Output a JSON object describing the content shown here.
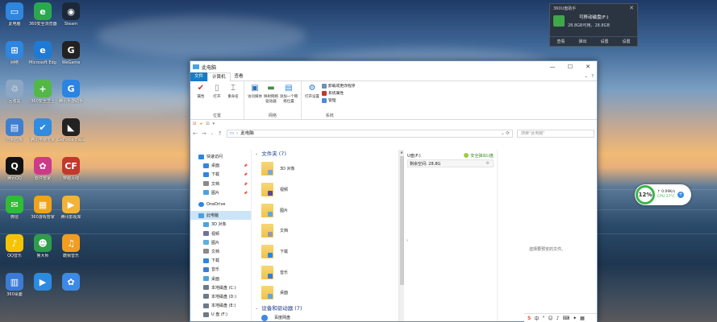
{
  "desktop": {
    "icons": [
      {
        "label": "此电脑",
        "color": "#2e86de",
        "glyph": "▭"
      },
      {
        "label": "360安全浏览器",
        "color": "#2aa84f",
        "glyph": "e"
      },
      {
        "label": "Steam",
        "color": "#1b2838",
        "glyph": "◉"
      },
      {
        "label": "网络",
        "color": "#2e86de",
        "glyph": "⊞"
      },
      {
        "label": "Microsoft Edge",
        "color": "#1f7ad6",
        "glyph": "e"
      },
      {
        "label": "WeGame",
        "color": "#222222",
        "glyph": "G"
      },
      {
        "label": "回收站",
        "color": "#8ca6c4",
        "glyph": "♲"
      },
      {
        "label": "360安全卫士",
        "color": "#53b848",
        "glyph": "+"
      },
      {
        "label": "腾讯手游助手",
        "color": "#2a84e0",
        "glyph": "G"
      },
      {
        "label": "控制面板",
        "color": "#3f7fd1",
        "glyph": "▤"
      },
      {
        "label": "腾讯电脑管家",
        "color": "#2f8ce0",
        "glyph": "✔"
      },
      {
        "label": "GeForce Experience",
        "color": "#222222",
        "glyph": "◣"
      },
      {
        "label": "腾讯QQ",
        "color": "#111111",
        "glyph": "Q"
      },
      {
        "label": "软件管家",
        "color": "#cc3b8a",
        "glyph": "✿"
      },
      {
        "label": "穿越火线",
        "color": "#c0392b",
        "glyph": "CF"
      },
      {
        "label": "微信",
        "color": "#2dbd36",
        "glyph": "✉"
      },
      {
        "label": "360游戏管家",
        "color": "#f0a21b",
        "glyph": "▦"
      },
      {
        "label": "腾讯影视库",
        "color": "#f4b23a",
        "glyph": "▶"
      },
      {
        "label": "QQ音乐",
        "color": "#f5c400",
        "glyph": "♪"
      },
      {
        "label": "鲁大师",
        "color": "#2f9c4c",
        "glyph": "☻"
      },
      {
        "label": "酷我音乐",
        "color": "#f29d1f",
        "glyph": "♫"
      },
      {
        "label": "360桌面",
        "color": "#3b7bd6",
        "glyph": "▥"
      },
      {
        "label": "",
        "color": "#2a8be0",
        "glyph": "▶"
      },
      {
        "label": "",
        "color": "#3b8be6",
        "glyph": "✿"
      }
    ]
  },
  "notification": {
    "header": "360U盘助手",
    "drive_name": "可移动磁盘(F:)",
    "size": "28.8GB可用，28.8GB",
    "actions": [
      "查看",
      "弹出",
      "设置",
      "设置"
    ]
  },
  "widget": {
    "percent": "12%",
    "speed": "↑ 0.09K/s",
    "speed2": "↓ 0.09K/s",
    "cpu": "CPU 37°C"
  },
  "window": {
    "title": "此电脑",
    "controls": {
      "min": "—",
      "max": "☐",
      "close": "✕"
    },
    "menus": {
      "file": "文件",
      "computer": "计算机",
      "view": "查看"
    },
    "ribbon": {
      "location": {
        "label": "位置",
        "buttons": [
          "属性",
          "打开",
          "重命名"
        ]
      },
      "network": {
        "label": "网络",
        "buttons": [
          "访问媒体",
          "映射网络驱动器",
          "添加一个网络位置"
        ]
      },
      "system": {
        "label": "系统",
        "open_settings": "打开设置",
        "items": [
          "卸载或更改程序",
          "系统属性",
          "管理"
        ]
      }
    },
    "address": {
      "path": "此电脑",
      "search_placeholder": "搜索\"此电脑\""
    },
    "nav": {
      "quick_access": "快速访问",
      "quick_items": [
        "桌面",
        "下载",
        "文档",
        "图片"
      ],
      "onedrive": "OneDrive",
      "this_pc": "此电脑",
      "pc_items": [
        "3D 对象",
        "视频",
        "图片",
        "文档",
        "下载",
        "音乐",
        "桌面",
        "本地磁盘 (C:)",
        "本地磁盘 (D:)",
        "本地磁盘 (E:)",
        "U 盘 (F:)"
      ]
    },
    "folders_header": "文件夹 (7)",
    "folders": [
      "3D 对象",
      "视频",
      "图片",
      "文档",
      "下载",
      "音乐",
      "桌面"
    ],
    "devices_header": "设备和驱动器 (7)",
    "device_first": "百度网盘",
    "drive": {
      "name": "U盘(F:)",
      "safe": "安全弹出U盘",
      "free": "剩余空间: 28.8G"
    },
    "preview_msg": "选择要预览的文件。"
  }
}
